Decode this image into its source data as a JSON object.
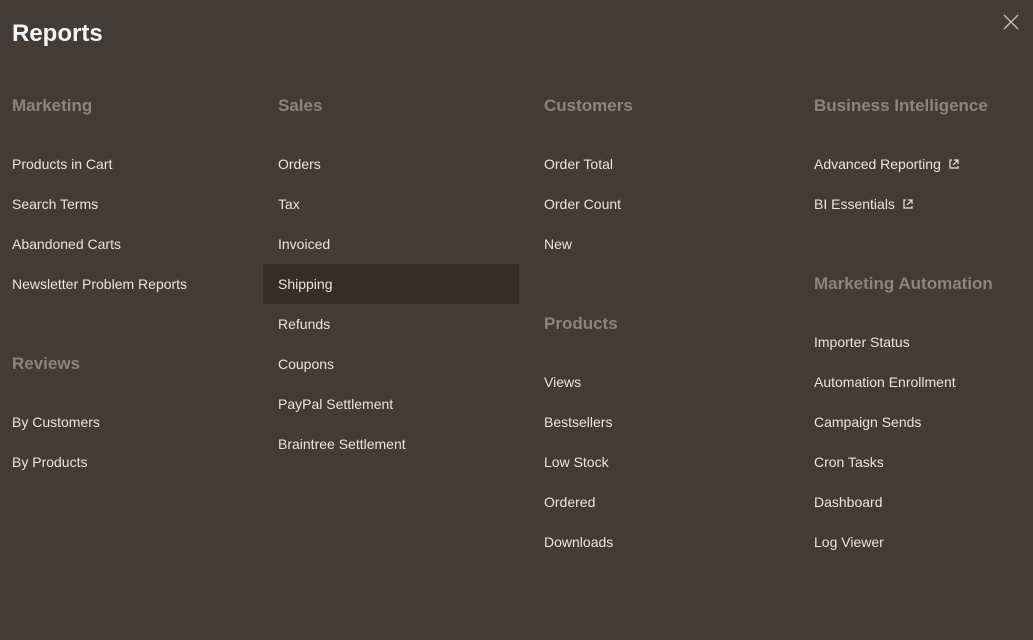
{
  "title": "Reports",
  "columns": {
    "marketing": {
      "title": "Marketing",
      "items": [
        {
          "label": "Products in Cart"
        },
        {
          "label": "Search Terms"
        },
        {
          "label": "Abandoned Carts"
        },
        {
          "label": "Newsletter Problem Reports"
        }
      ]
    },
    "reviews": {
      "title": "Reviews",
      "items": [
        {
          "label": "By Customers"
        },
        {
          "label": "By Products"
        }
      ]
    },
    "sales": {
      "title": "Sales",
      "items": [
        {
          "label": "Orders"
        },
        {
          "label": "Tax"
        },
        {
          "label": "Invoiced"
        },
        {
          "label": "Shipping"
        },
        {
          "label": "Refunds"
        },
        {
          "label": "Coupons"
        },
        {
          "label": "PayPal Settlement"
        },
        {
          "label": "Braintree Settlement"
        }
      ]
    },
    "customers": {
      "title": "Customers",
      "items": [
        {
          "label": "Order Total"
        },
        {
          "label": "Order Count"
        },
        {
          "label": "New"
        }
      ]
    },
    "products": {
      "title": "Products",
      "items": [
        {
          "label": "Views"
        },
        {
          "label": "Bestsellers"
        },
        {
          "label": "Low Stock"
        },
        {
          "label": "Ordered"
        },
        {
          "label": "Downloads"
        }
      ]
    },
    "bi": {
      "title": "Business Intelligence",
      "items": [
        {
          "label": "Advanced Reporting",
          "external": true
        },
        {
          "label": "BI Essentials",
          "external": true
        }
      ]
    },
    "automation": {
      "title": "Marketing Automation",
      "items": [
        {
          "label": "Importer Status"
        },
        {
          "label": "Automation Enrollment"
        },
        {
          "label": "Campaign Sends"
        },
        {
          "label": "Cron Tasks"
        },
        {
          "label": "Dashboard"
        },
        {
          "label": "Log Viewer"
        }
      ]
    }
  },
  "hovered_item": "Shipping"
}
